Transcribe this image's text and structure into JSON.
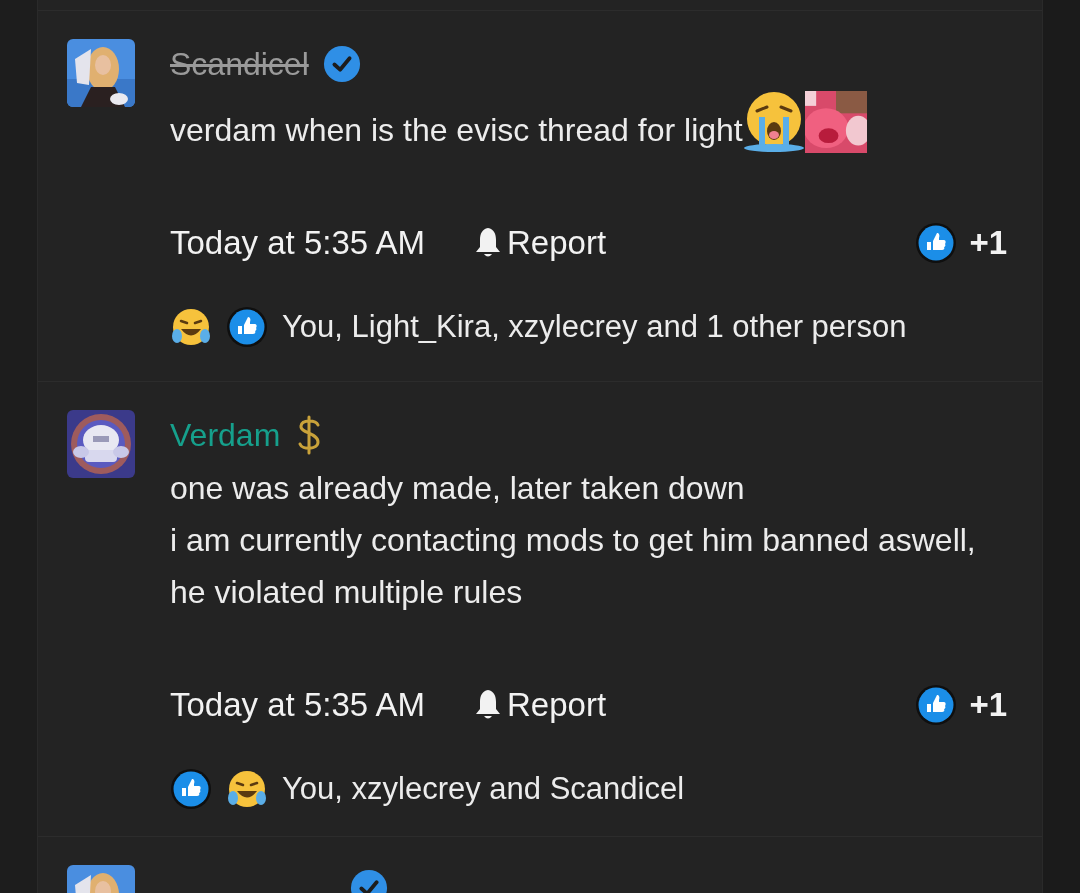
{
  "posts": [
    {
      "author": {
        "name": "Scandicel",
        "struck": true,
        "color": "#9a9a9a",
        "badge": {
          "kind": "verified"
        }
      },
      "avatar": {
        "kind": "picture"
      },
      "body": [
        {
          "kind": "text",
          "text": "verdam when is the evisc thread for light"
        },
        {
          "kind": "sob"
        },
        {
          "kind": "sticker"
        }
      ],
      "time": "Today at 5:35 AM",
      "report": "Report",
      "like_count": "+1",
      "reactions": [
        {
          "kind": "laugh"
        },
        {
          "kind": "like"
        }
      ],
      "reacted_by": "You, Light_Kira, xzylecrey and 1 other person"
    },
    {
      "author": {
        "name": "Verdam",
        "struck": false,
        "color": "#16a08c",
        "badge": {
          "kind": "dollar"
        }
      },
      "avatar": {
        "kind": "picture"
      },
      "body": [
        {
          "kind": "text",
          "text": "one was already made, later taken down"
        },
        {
          "kind": "break"
        },
        {
          "kind": "text",
          "text": "i am currently contacting mods to get him banned aswell, he violated multiple rules"
        }
      ],
      "time": "Today at 5:35 AM",
      "report": "Report",
      "like_count": "+1",
      "reactions": [
        {
          "kind": "like"
        },
        {
          "kind": "laugh"
        }
      ],
      "reacted_by": "You, xzylecrey and Scandicel"
    }
  ],
  "partial_post": {
    "author": {
      "badge": {
        "kind": "verified"
      }
    }
  }
}
